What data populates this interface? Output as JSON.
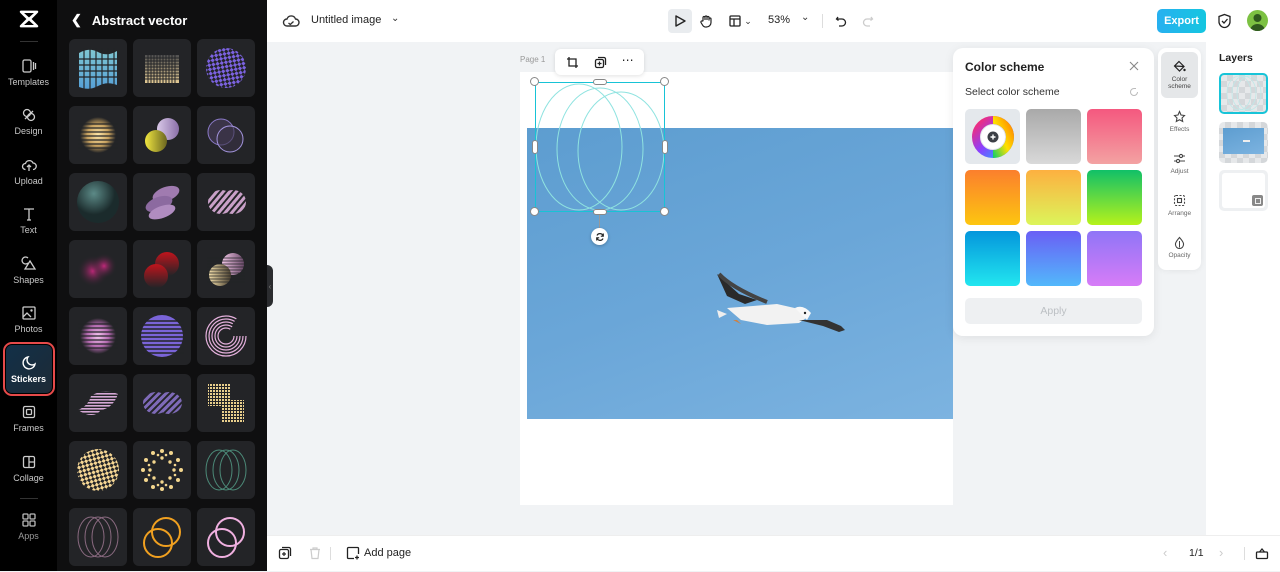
{
  "app": {
    "brand_icon": "capcut-logo-icon"
  },
  "rail": {
    "items": [
      {
        "label": "Templates",
        "icon": "templates-icon"
      },
      {
        "label": "Design",
        "icon": "design-icon"
      },
      {
        "label": "Upload",
        "icon": "upload-cloud-icon"
      },
      {
        "label": "Text",
        "icon": "text-icon"
      },
      {
        "label": "Shapes",
        "icon": "shapes-icon"
      },
      {
        "label": "Photos",
        "icon": "photos-icon"
      },
      {
        "label": "Stickers",
        "icon": "stickers-icon",
        "active": true
      },
      {
        "label": "Frames",
        "icon": "frames-icon"
      },
      {
        "label": "Collage",
        "icon": "collage-icon"
      },
      {
        "label": "Apps",
        "icon": "apps-icon"
      }
    ]
  },
  "panel": {
    "title": "Abstract vector",
    "back_icon": "chevron-left-icon",
    "stickers": [
      "cyan wave grid",
      "cream dot gradient",
      "purple checker sphere",
      "cream halftone sphere",
      "yellow and lilac spheres",
      "purple overlapping circles",
      "teal mesh sphere",
      "lilac stacked discs",
      "pink striped discs",
      "magenta swirl",
      "red spheres",
      "cream and pink spheres",
      "pink halftone sphere",
      "purple striped sphere",
      "pink concentric ring",
      "pink wavy shape",
      "purple striped discs",
      "cream dot squares",
      "cream checker sphere",
      "cream dot ring",
      "green outline ovals",
      "mauve outline ovals",
      "orange outline circles",
      "pink outline circles"
    ]
  },
  "topbar": {
    "title": "Untitled image",
    "zoom": "53%",
    "export_label": "Export"
  },
  "canvas": {
    "page_label": "Page 1"
  },
  "color_scheme": {
    "title": "Color scheme",
    "subtitle": "Select color scheme",
    "apply_label": "Apply",
    "swatches": [
      {
        "name": "custom",
        "icon": "color-wheel-icon"
      },
      {
        "name": "gray",
        "from": "#a9a9a9",
        "to": "#d6d6d6"
      },
      {
        "name": "pink",
        "from": "#f4587f",
        "to": "#f0a0a0"
      },
      {
        "name": "orange",
        "from": "#fb7f2d",
        "to": "#fdc610"
      },
      {
        "name": "yellow",
        "from": "#fdb040",
        "to": "#dcf55a"
      },
      {
        "name": "green",
        "from": "#11c068",
        "to": "#b6f21b"
      },
      {
        "name": "cyan",
        "from": "#0496dc",
        "to": "#22e6ef"
      },
      {
        "name": "blue",
        "from": "#6a5ff5",
        "to": "#52b8fb"
      },
      {
        "name": "violet",
        "from": "#8f75f7",
        "to": "#d77cf7"
      }
    ]
  },
  "side_tools": [
    {
      "label": "Color scheme",
      "icon": "paint-bucket-icon",
      "active": true
    },
    {
      "label": "Effects",
      "icon": "effects-star-icon"
    },
    {
      "label": "Adjust",
      "icon": "sliders-icon"
    },
    {
      "label": "Arrange",
      "icon": "arrange-icon"
    },
    {
      "label": "Opacity",
      "icon": "opacity-drop-icon"
    }
  ],
  "layers": {
    "title": "Layers"
  },
  "bottombar": {
    "add_page_label": "Add page",
    "page_counter": "1/1"
  }
}
